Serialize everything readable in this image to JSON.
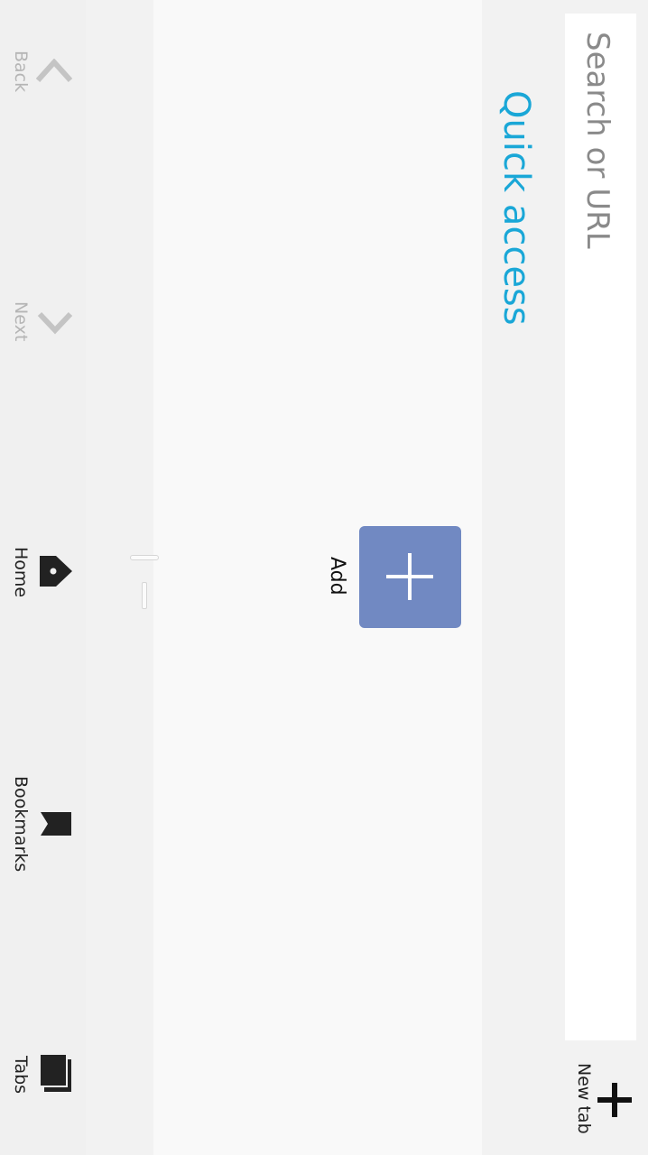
{
  "search": {
    "placeholder": "Search or URL"
  },
  "new_tab": {
    "label": "New tab",
    "icon": "plus-icon"
  },
  "quick_access": {
    "title": "Quick access",
    "title_color": "#1aa7d7",
    "tiles": [
      {
        "label": "Add",
        "icon": "plus-icon",
        "color": "#7189c2"
      }
    ]
  },
  "nav": {
    "items": [
      {
        "label": "Back",
        "icon": "chevron-left-icon",
        "enabled": false
      },
      {
        "label": "Next",
        "icon": "chevron-right-icon",
        "enabled": false
      },
      {
        "label": "Home",
        "icon": "home-icon",
        "enabled": true
      },
      {
        "label": "Bookmarks",
        "icon": "bookmark-icon",
        "enabled": true
      },
      {
        "label": "Tabs",
        "icon": "tabs-icon",
        "enabled": true
      }
    ]
  }
}
